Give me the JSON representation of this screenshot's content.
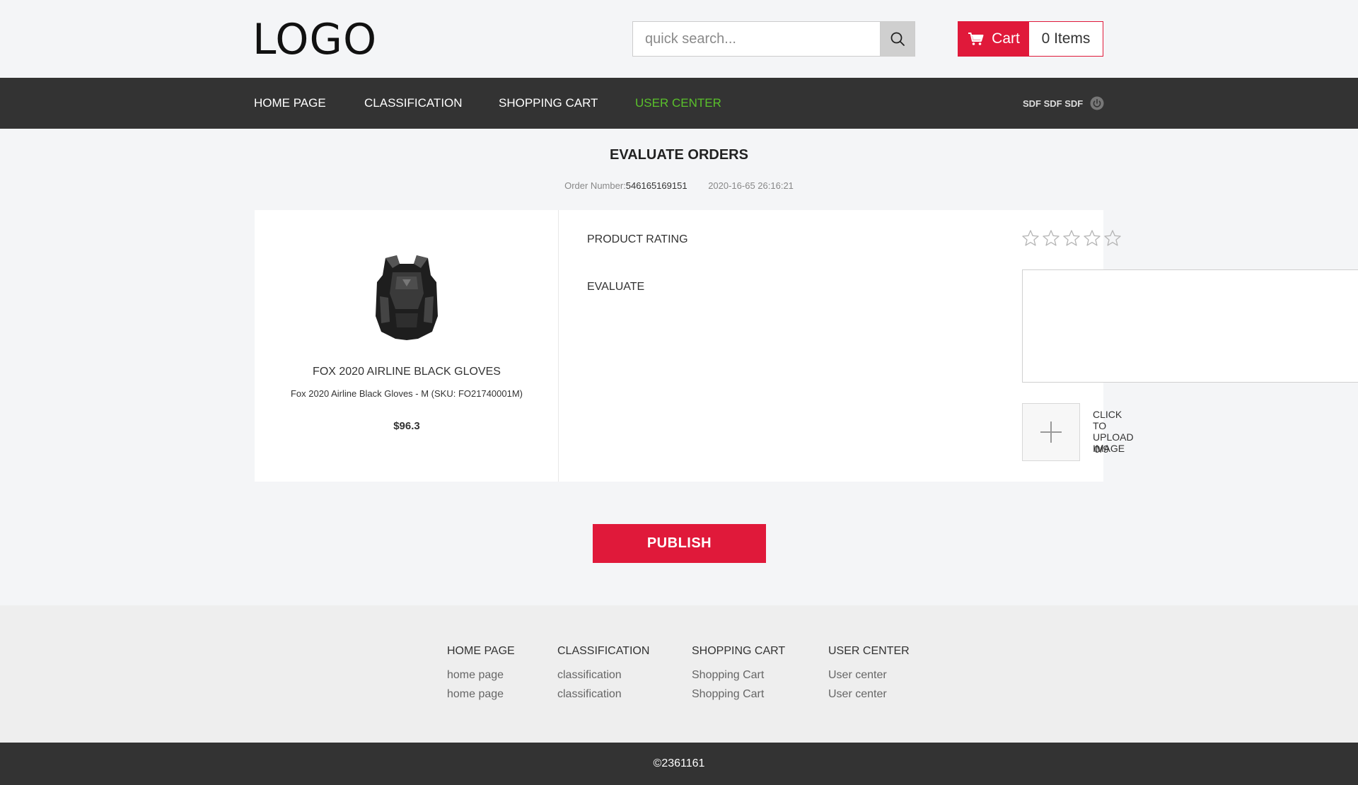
{
  "header": {
    "logo": "LOGO",
    "search_placeholder": "quick search...",
    "cart_label": "Cart",
    "cart_count": "0 Items"
  },
  "nav": {
    "items": [
      "HOME PAGE",
      "CLASSIFICATION",
      "SHOPPING CART",
      "USER CENTER"
    ],
    "active": "USER CENTER",
    "user": "SDF SDF SDF",
    "accent_color": "#5ac12b"
  },
  "main": {
    "title": "EVALUATE ORDERS",
    "order_label": "Order Number:",
    "order_number": "546165169151",
    "order_date": "2020-16-65 26:16:21",
    "product": {
      "name": "FOX 2020 AIRLINE BLACK GLOVES",
      "sku": "Fox 2020 Airline Black Gloves - M (SKU: FO21740001M)",
      "price": "$96.3"
    },
    "rating_label": "PRODUCT RATING",
    "rating": 0,
    "rating_max": 5,
    "evaluate_label": "EVALUATE",
    "evaluate_value": "",
    "upload_label": "CLICK TO UPLOAD IMAGE",
    "upload_count": "0/9",
    "publish_label": "PUBLISH",
    "brand_color": "#e0193a"
  },
  "footer": {
    "columns": [
      {
        "heading": "HOME PAGE",
        "links": [
          "home page",
          "home page"
        ]
      },
      {
        "heading": "CLASSIFICATION",
        "links": [
          "classification",
          "classification"
        ]
      },
      {
        "heading": "SHOPPING CART",
        "links": [
          "Shopping Cart",
          "Shopping Cart"
        ]
      },
      {
        "heading": "USER CENTER",
        "links": [
          "User center",
          "User center"
        ]
      }
    ],
    "copyright": "©2361161"
  }
}
